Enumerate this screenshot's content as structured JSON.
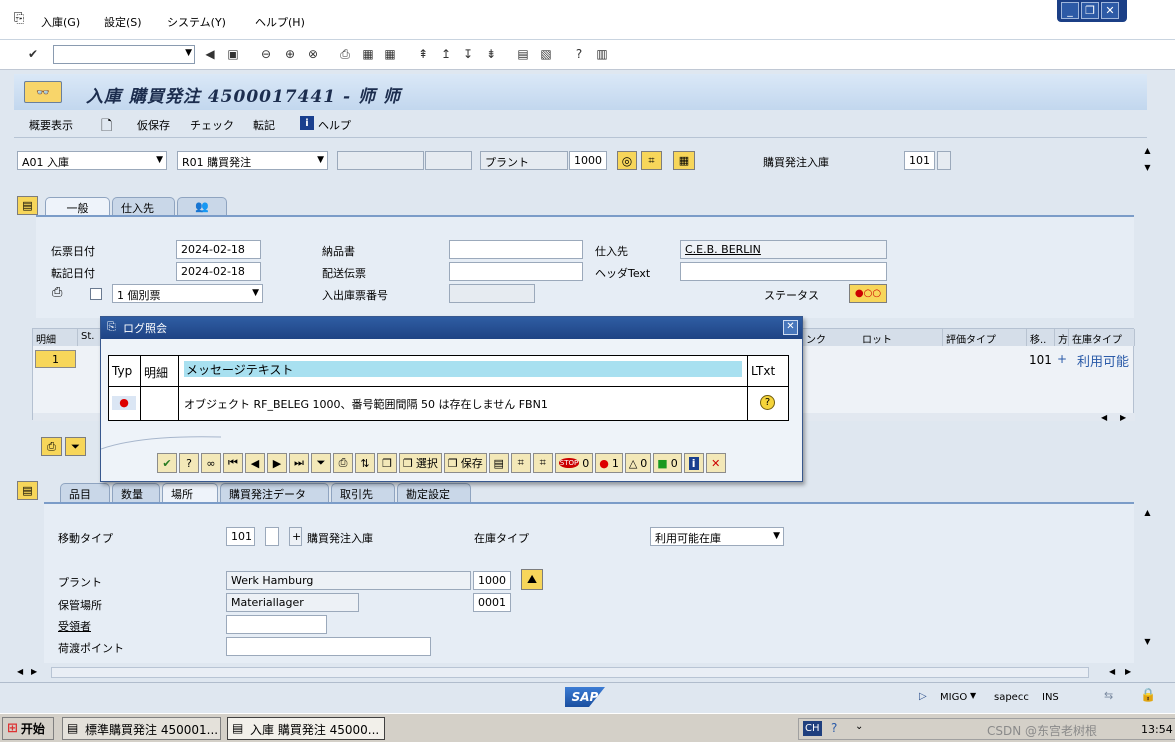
{
  "menubar": {
    "items": [
      "入庫(G)",
      "設定(S)",
      "システム(Y)",
      "ヘルプ(H)"
    ]
  },
  "title": "入庫 購買発注 4500017441 - 师 师",
  "app_toolbar": {
    "overview": "概要表示",
    "hold": "仮保存",
    "check": "チェック",
    "post": "転記",
    "help": "ヘルプ"
  },
  "header": {
    "action": "A01 入庫",
    "ref_doc": "R01 購買発注",
    "plant_label": "プラント",
    "plant_value": "1000",
    "movement_label": "購買発注入庫",
    "movement_value": "101"
  },
  "top_tabs": [
    "一般",
    "仕入先"
  ],
  "general": {
    "doc_date_label": "伝票日付",
    "doc_date": "2024-02-18",
    "post_date_label": "転記日付",
    "post_date": "2024-02-18",
    "slip_type": "1 個別票",
    "delivery_note_label": "納品書",
    "bill_lading_label": "配送伝票",
    "gr_slip_label": "入出庫票番号",
    "vendor_label": "仕入先",
    "vendor": "C.E.B. BERLIN",
    "header_text_label": "ヘッダText",
    "status_label": "ステータス"
  },
  "items_table": {
    "headers": [
      "明細",
      "St.",
      "ンク",
      "ロット",
      "評価タイプ",
      "移..",
      "方",
      "在庫タイプ"
    ],
    "row": {
      "line": "1",
      "mvt": "101",
      "dir": "+",
      "stock_type": "利用可能"
    }
  },
  "dialog": {
    "title": "ログ照会",
    "headers": {
      "type": "Typ",
      "item": "明細",
      "message": "メッセージテキスト",
      "ltxt": "LTxt"
    },
    "message": "オブジェクト RF_BELEG 1000、番号範囲間隔 50 は存在しません FBN1",
    "buttons": {
      "select": "選択",
      "save": "保存",
      "stop_count": "0",
      "error_count": "1",
      "warn_count": "0",
      "ok_count": "0"
    }
  },
  "detail_tabs": [
    "品目",
    "数量",
    "場所",
    "購買発注データ",
    "取引先",
    "勘定設定"
  ],
  "detail": {
    "mvt_type_label": "移動タイプ",
    "mvt_type": "101",
    "sign": "+",
    "mvt_text": "購買発注入庫",
    "stock_type_label": "在庫タイプ",
    "stock_type": "利用可能在庫",
    "plant_label": "プラント",
    "plant_name": "Werk Hamburg",
    "plant_code": "1000",
    "sloc_label": "保管場所",
    "sloc_name": "Materiallager",
    "sloc_code": "0001",
    "recipient_label": "受領者",
    "unloading_label": "荷渡ポイント"
  },
  "statusbar": {
    "tcode": "MIGO",
    "system": "sapecc",
    "mode": "INS"
  },
  "taskbar": {
    "start": "开始",
    "tasks": [
      "標準購買発注 450001...",
      "入庫 購買発注 45000..."
    ],
    "lang": "CH",
    "clock": "13:54",
    "watermark": "CSDN @东宫老树根"
  }
}
